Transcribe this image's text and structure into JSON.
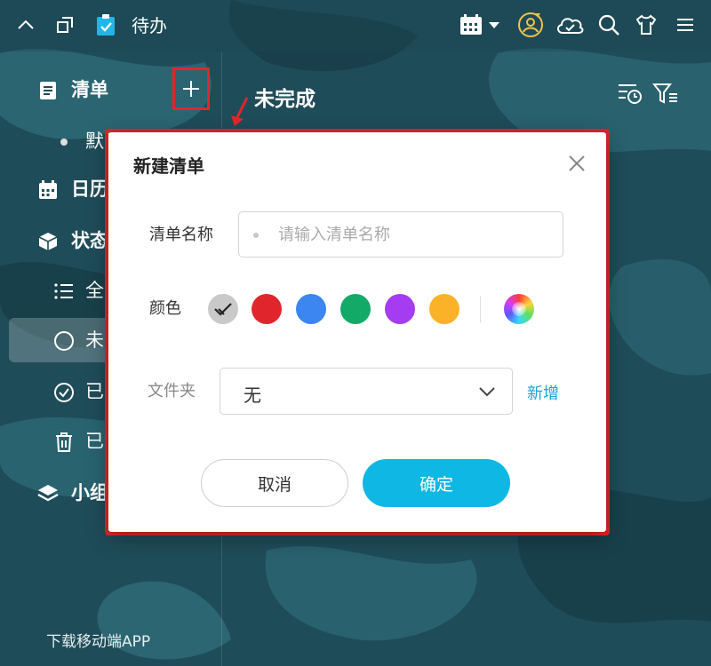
{
  "app": {
    "title": "待办"
  },
  "sidebar": {
    "items": [
      {
        "label": "清单",
        "icon": "list-doc-icon"
      },
      {
        "label": "默认",
        "icon": "dot-icon"
      },
      {
        "label": "日历",
        "icon": "calendar-icon"
      },
      {
        "label": "状态",
        "icon": "cube-icon"
      },
      {
        "label": "全部",
        "icon": "bullet-list-icon"
      },
      {
        "label": "未完成",
        "icon": "circle-icon"
      },
      {
        "label": "已完成",
        "icon": "check-circle-icon"
      },
      {
        "label": "已删除",
        "icon": "trash-icon"
      },
      {
        "label": "小组",
        "icon": "layers-icon"
      }
    ],
    "bottom_link": "下载移动端APP"
  },
  "main": {
    "title": "未完成"
  },
  "dialog": {
    "title": "新建清单",
    "name_label": "清单名称",
    "name_placeholder": "请输入清单名称",
    "name_value": "",
    "color_label": "颜色",
    "colors": [
      "#c9c9c9",
      "#e0262c",
      "#3b86f0",
      "#12aa66",
      "#a53cf2",
      "#fbb128"
    ],
    "selected_color_index": 0,
    "folder_label": "文件夹",
    "folder_value": "无",
    "add_folder_link": "新增",
    "cancel_label": "取消",
    "confirm_label": "确定"
  },
  "colors": {
    "accent": "#0fb8e4",
    "highlight": "#e3262a",
    "link": "#1aa3d6"
  }
}
